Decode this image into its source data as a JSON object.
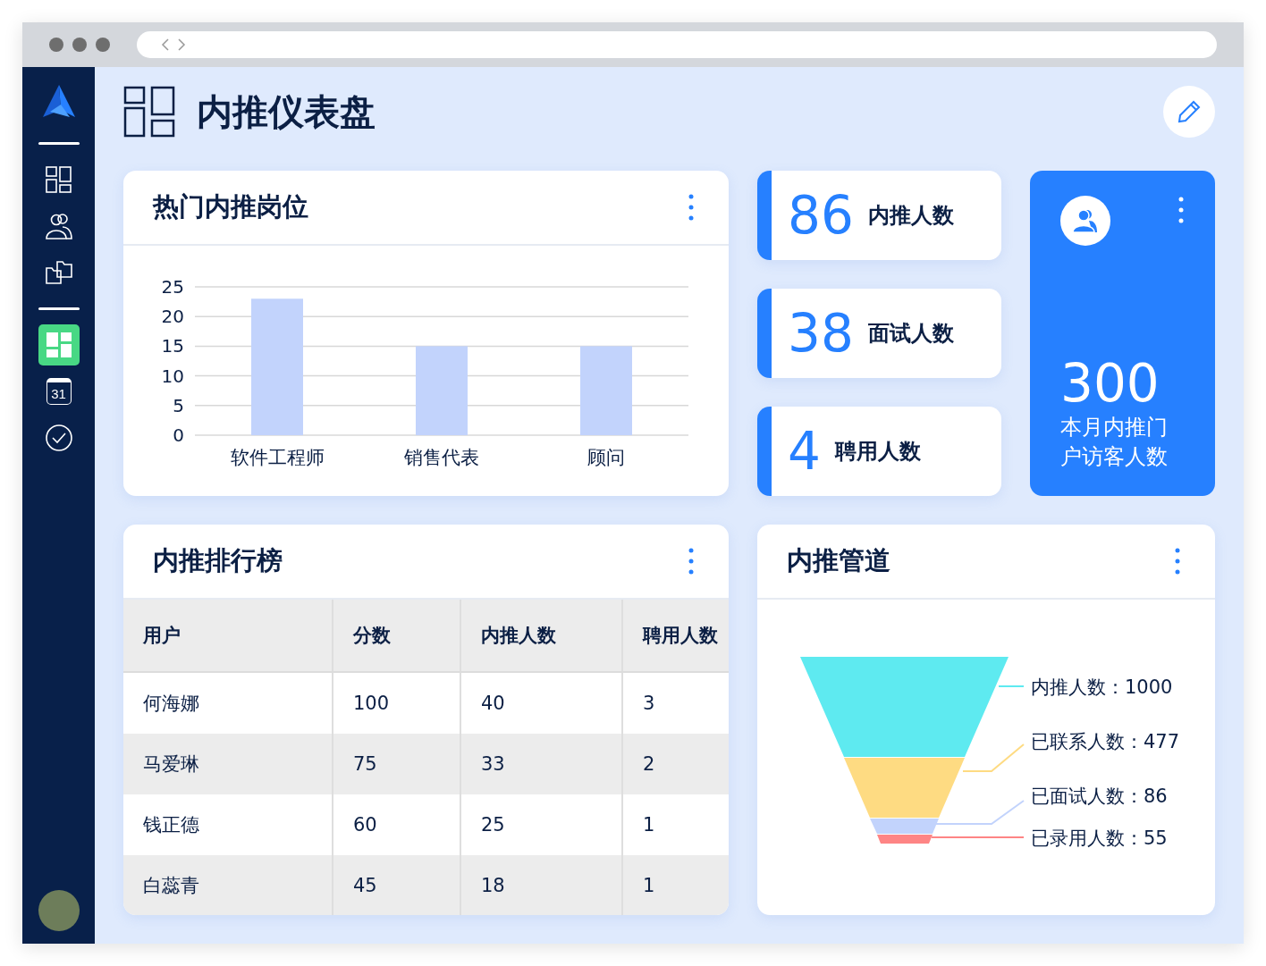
{
  "sidebar": {
    "items": [
      {
        "kind": "grid",
        "selected": false
      },
      {
        "kind": "people",
        "selected": false
      },
      {
        "kind": "folders",
        "selected": false
      },
      {
        "kind": "divider"
      },
      {
        "kind": "dashboard",
        "selected": true
      },
      {
        "kind": "calendar",
        "selected": false,
        "label": "31"
      },
      {
        "kind": "check",
        "selected": false
      }
    ]
  },
  "header": {
    "title": "内推仪表盘"
  },
  "top_positions": {
    "title": "热门内推岗位",
    "chart_data": {
      "type": "bar",
      "categories": [
        "软件工程师",
        "销售代表",
        "顾问"
      ],
      "values": [
        23,
        15,
        15
      ],
      "ylim": [
        0,
        25
      ],
      "yticks": [
        0,
        5,
        10,
        15,
        20,
        25
      ],
      "grid": true
    }
  },
  "stats": [
    {
      "value": "86",
      "label": "内推人数"
    },
    {
      "value": "38",
      "label": "面试人数"
    },
    {
      "value": "4",
      "label": "聘用人数"
    }
  ],
  "visitors": {
    "value": "300",
    "label_lines": [
      "本月内推门",
      "户访客人数"
    ]
  },
  "leaderboard": {
    "title": "内推排行榜",
    "columns": [
      "用户",
      "分数",
      "内推人数",
      "聘用人数"
    ],
    "rows": [
      [
        "何海娜",
        "100",
        "40",
        "3"
      ],
      [
        "马爱琳",
        "75",
        "33",
        "2"
      ],
      [
        "钱正德",
        "60",
        "25",
        "1"
      ],
      [
        "白蕊青",
        "45",
        "18",
        "1"
      ]
    ]
  },
  "pipeline": {
    "title": "内推管道",
    "stages": [
      {
        "label": "内推人数：1000",
        "color": "#5eeaf0"
      },
      {
        "label": "已联系人数：477",
        "color": "#fedb82"
      },
      {
        "label": "已面试人数：86",
        "color": "#c2d3fc"
      },
      {
        "label": "已录用人数：55",
        "color": "#fe8585"
      }
    ]
  }
}
